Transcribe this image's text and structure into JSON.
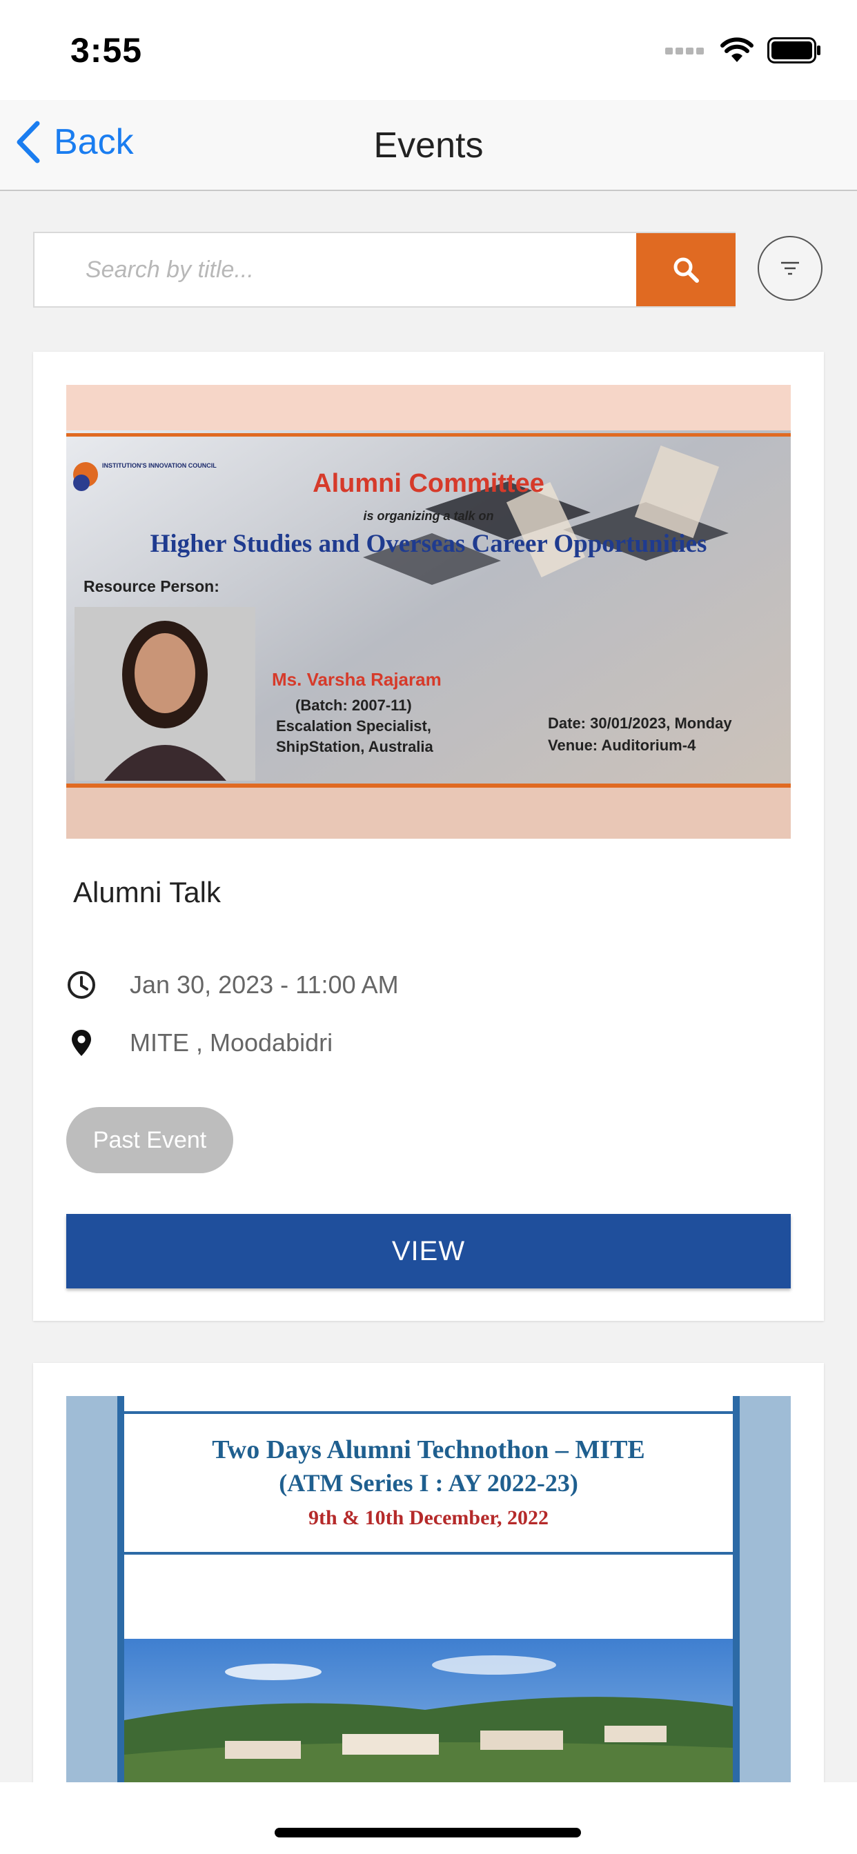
{
  "status_bar": {
    "time": "3:55"
  },
  "nav": {
    "back_label": "Back",
    "title": "Events"
  },
  "search": {
    "placeholder": "Search by title..."
  },
  "events": [
    {
      "title": "Alumni Talk",
      "date_time": "Jan 30, 2023 - 11:00 AM",
      "location": "MITE , Moodabidri",
      "status_badge": "Past Event",
      "view_label": "VIEW",
      "poster": {
        "logo_text": "INSTITUTION'S INNOVATION COUNCIL",
        "heading": "Alumni Committee",
        "subheading": "is organizing a talk on",
        "topic": "Higher Studies and Overseas Career Opportunities",
        "resource_label": "Resource Person:",
        "speaker_name": "Ms. Varsha Rajaram",
        "speaker_batch": "(Batch: 2007-11)",
        "speaker_role_1": "Escalation Specialist,",
        "speaker_role_2": "ShipStation, Australia",
        "date_line": "Date: 30/01/2023, Monday",
        "venue_line": "Venue: Auditorium-4"
      }
    },
    {
      "poster": {
        "line1": "Two Days Alumni Technothon – MITE",
        "line2": "(ATM Series I : AY 2022-23)",
        "line3": "9th & 10th December, 2022"
      }
    }
  ],
  "colors": {
    "accent_orange": "#e06a22",
    "view_blue": "#1f4f9c",
    "link_blue": "#1a7df0",
    "badge_gray": "#bdbdbd"
  }
}
